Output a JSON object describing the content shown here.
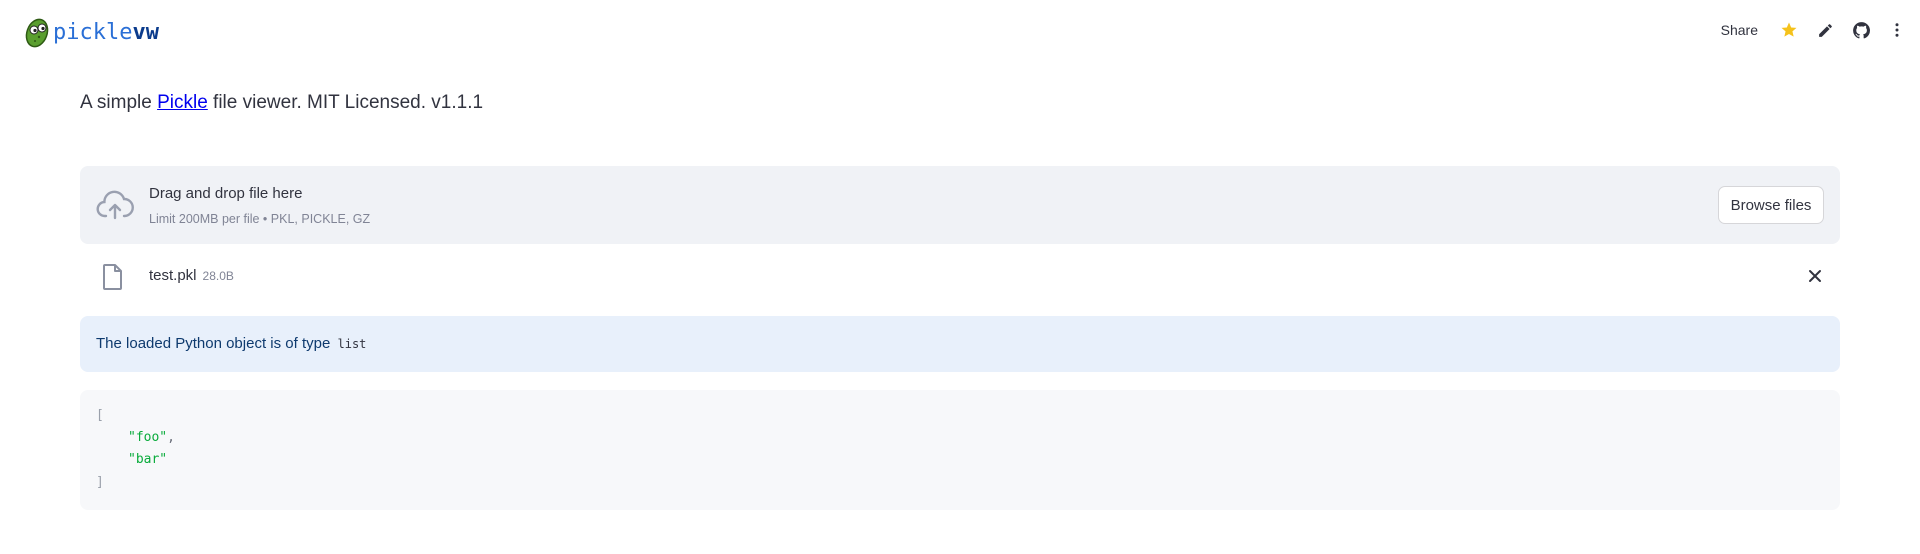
{
  "app": {
    "logo_text_main": "pickle",
    "logo_text_accent": "vw"
  },
  "toolbar": {
    "share_label": "Share",
    "icons": [
      "star-icon",
      "pencil-icon",
      "github-icon",
      "more-vertical-icon"
    ],
    "star_color": "#f5c21b"
  },
  "intro": {
    "prefix": "A simple ",
    "link_text": "Pickle",
    "suffix": " file viewer. MIT Licensed. v1.1.1"
  },
  "uploader": {
    "title": "Drag and drop file here",
    "subtitle": "Limit 200MB per file • PKL, PICKLE, GZ",
    "browse_label": "Browse files"
  },
  "file": {
    "name": "test.pkl",
    "size": "28.0B"
  },
  "info": {
    "text": "The loaded Python object is of type",
    "type_code": "list"
  },
  "json_view": {
    "open_bracket": "[",
    "items": [
      "\"foo\"",
      "\"bar\""
    ],
    "close_bracket": "]"
  },
  "colors": {
    "info_bg": "#e8f0fb",
    "dropzone_bg": "#f0f2f6",
    "json_string": "#09ab3b"
  }
}
